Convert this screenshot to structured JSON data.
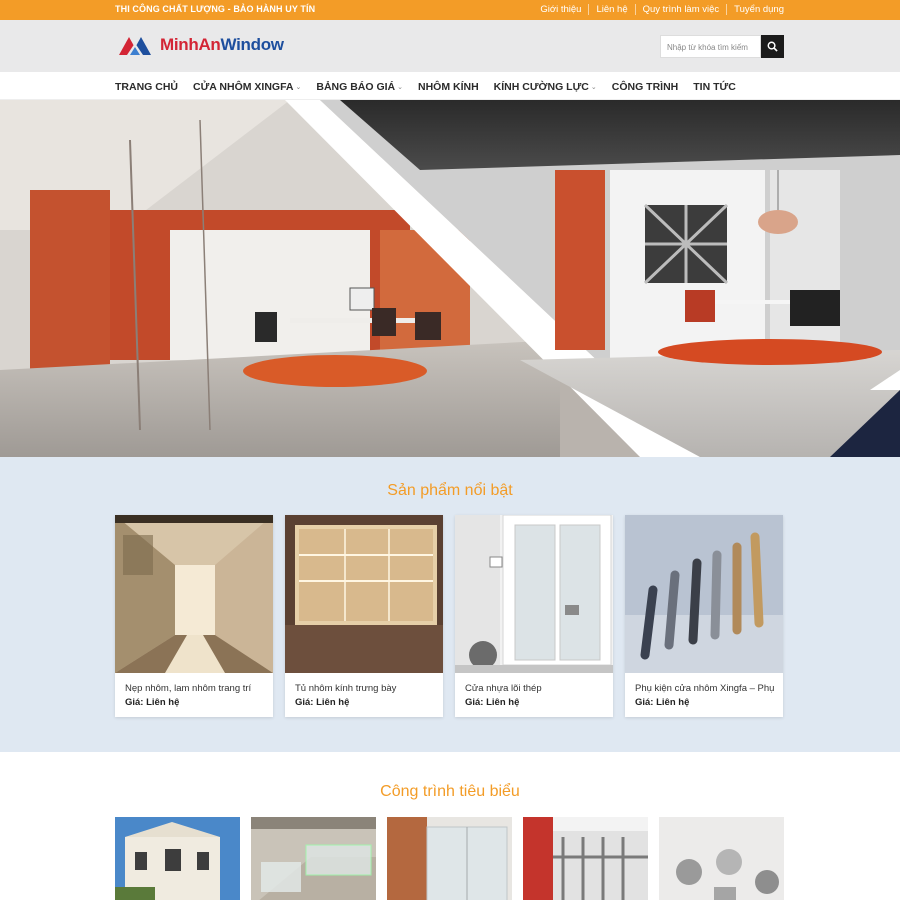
{
  "topbar": {
    "slogan": "THI CÔNG CHẤT LƯỢNG - BẢO HÀNH UY TÍN",
    "links": [
      "Giới thiệu",
      "Liên hệ",
      "Quy trình làm việc",
      "Tuyển dụng"
    ]
  },
  "header": {
    "logo_part1": "MinhAn",
    "logo_part2": "Window",
    "search_placeholder": "Nhập từ khóa tìm kiếm"
  },
  "nav": {
    "items": [
      "TRANG CHỦ",
      "CỬA NHÔM XINGFA",
      "BẢNG BÁO GIÁ",
      "NHÔM KÍNH",
      "KÍNH CƯỜNG LỰC",
      "CÔNG TRÌNH",
      "TIN TỨC"
    ]
  },
  "hero": {
    "slide_count": 2,
    "active_slide": 1
  },
  "featured": {
    "title": "Sản phẩm nổi bật",
    "products": [
      {
        "name": "Nẹp nhôm, lam nhôm trang trí",
        "price": "Giá: Liên hệ"
      },
      {
        "name": "Tủ nhôm kính trưng bày",
        "price": "Giá: Liên hệ"
      },
      {
        "name": "Cửa nhựa lõi thép",
        "price": "Giá: Liên hệ"
      },
      {
        "name": "Phụ kiện cửa nhôm Xingfa – Phụ",
        "price": "Giá: Liên hệ"
      }
    ]
  },
  "projects": {
    "title": "Công trình tiêu biểu"
  },
  "colors": {
    "accent": "#f39c27",
    "logo_red": "#d32535",
    "logo_blue": "#1e4f9e",
    "featured_bg": "#dfe8f2"
  }
}
